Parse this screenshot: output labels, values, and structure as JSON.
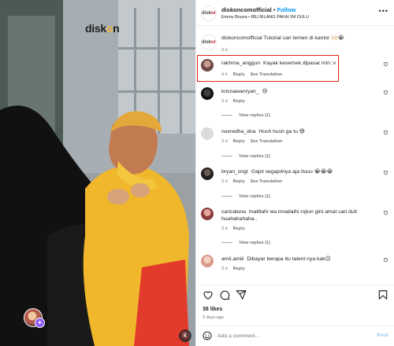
{
  "media": {
    "watermark_main": "disk",
    "watermark_accent": "o",
    "watermark_end": "n",
    "badge_icon": "reel-badge-icon",
    "mute_icon": "muted-speaker-icon"
  },
  "header": {
    "avatar_text_a": "disk",
    "avatar_text_b": "on",
    "username": "diskoncomofficial",
    "separator": " • ",
    "follow_label": "Follow",
    "audio_text": "Emmy Boyea • IBU BILANG PAKAI INI DULU",
    "more_icon": "more-horizontal-icon"
  },
  "caption": {
    "username": "diskoncomofficial",
    "text": "Tutorial cari temen di kantor 🙌🏻😭",
    "time": "3 d"
  },
  "comments": [
    {
      "username": "rakhma_anggun",
      "text": "Kayak kesemek dipasar min :v",
      "time": "4 h",
      "reply": "Reply",
      "translate": "See Translation",
      "view_replies": ""
    },
    {
      "username": "krisnawanryan_",
      "text": "😢",
      "time": "3 d",
      "reply": "Reply",
      "translate": "",
      "view_replies": "View replies (1)"
    },
    {
      "username": "novredha_dna",
      "text": "Hush hush ga tu 😅",
      "time": "3 d",
      "reply": "Reply",
      "translate": "See Translation",
      "view_replies": "View replies (1)"
    },
    {
      "username": "bryan_sngr",
      "text": "Gajol segajolnya aja ituuu 😭😭😭",
      "time": "3 d",
      "reply": "Reply",
      "translate": "See Translation",
      "view_replies": "View replies (1)"
    },
    {
      "username": "caricaluna",
      "text": "Inalillahi wa innailaihi rojiun gini amat cari duit huahahahaha..",
      "time": "3 d",
      "reply": "Reply",
      "translate": "",
      "view_replies": "View replies (1)"
    },
    {
      "username": "amii.amiii",
      "text": "Dibayar berapa itu talent nya kak😉",
      "time": "3 d",
      "reply": "Reply",
      "translate": "",
      "view_replies": ""
    }
  ],
  "actions": {
    "like_icon": "heart-icon",
    "comment_icon": "comment-icon",
    "share_icon": "share-icon",
    "save_icon": "bookmark-icon",
    "likes": "38 likes",
    "date": "3 days ago"
  },
  "add_comment": {
    "emoji_icon": "emoji-icon",
    "placeholder": "Add a comment…",
    "post_label": "Post"
  },
  "colors": {
    "accent_blue": "#0095f6",
    "highlight_red": "#e0201b",
    "text_primary": "#262626",
    "text_secondary": "#737373",
    "post_disabled": "#8fcaf6"
  }
}
